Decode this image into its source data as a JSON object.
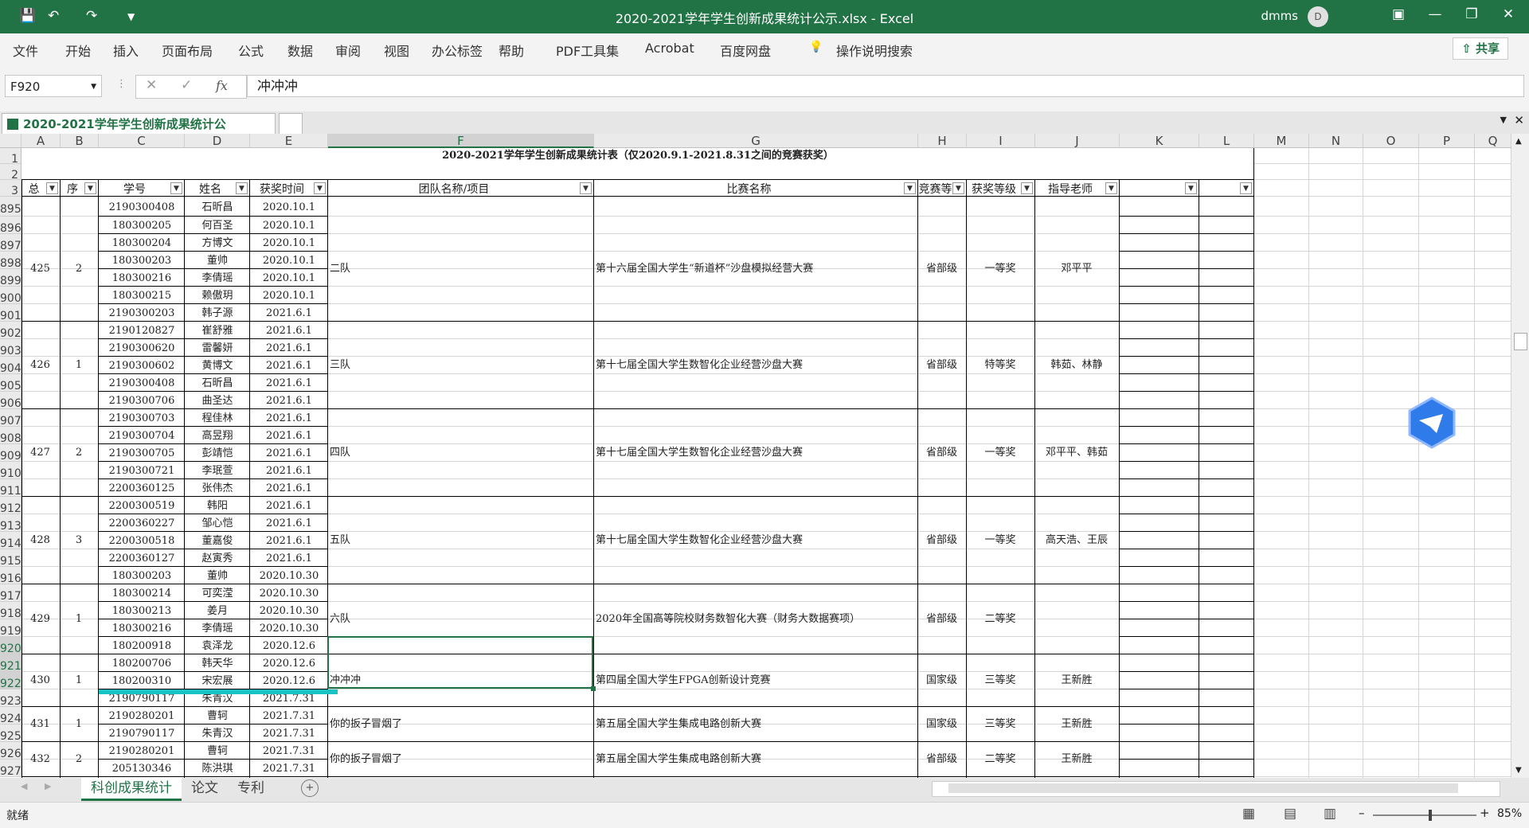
{
  "window": {
    "title": "2020-2021学年学生创新成果统计公示.xlsx  -  Excel",
    "user": "dmms",
    "avatar_letter": "D"
  },
  "menu": [
    "文件",
    "开始",
    "插入",
    "页面布局",
    "公式",
    "数据",
    "审阅",
    "视图",
    "办公标签",
    "帮助",
    "PDF工具集",
    "Acrobat",
    "百度网盘"
  ],
  "search_label": "操作说明搜索",
  "share_label": "共享",
  "formula_bar": {
    "name_box": "F920",
    "content": "冲冲冲",
    "fx": "fx"
  },
  "workbook_tab": {
    "label": "2020-2021学年学生创新成果统计公示.xlsx",
    "icon": "excel-icon"
  },
  "columns": [
    "A",
    "B",
    "C",
    "D",
    "E",
    "F",
    "G",
    "H",
    "I",
    "J",
    "K",
    "L",
    "M",
    "N",
    "O",
    "P",
    "Q"
  ],
  "sheet_title": "2020-2021学年学生创新成果统计表（仅2020.9.1-2021.8.31之间的竞赛获奖）",
  "headers": {
    "A": "总",
    "B": "序",
    "C": "学号",
    "D": "姓名",
    "E": "获奖时间",
    "F": "团队名称/项目",
    "G": "比赛名称",
    "H": "竞赛等",
    "I": "获奖等级",
    "J": "指导老师"
  },
  "rows_visible": [
    "1",
    "2",
    "3",
    "895",
    "896",
    "897",
    "898",
    "899",
    "900",
    "901",
    "902",
    "903",
    "904",
    "905",
    "906",
    "907",
    "908",
    "909",
    "910",
    "911",
    "912",
    "913",
    "914",
    "915",
    "916",
    "917",
    "918",
    "919",
    "920",
    "921",
    "922",
    "923",
    "924",
    "925",
    "926",
    "927"
  ],
  "students": [
    [
      "2190300408",
      "石昕昌",
      "2020.10.1"
    ],
    [
      "180300205",
      "何百圣",
      "2020.10.1"
    ],
    [
      "180300204",
      "方博文",
      "2020.10.1"
    ],
    [
      "180300203",
      "董帅",
      "2020.10.1"
    ],
    [
      "180300216",
      "李倩瑶",
      "2020.10.1"
    ],
    [
      "180300215",
      "赖傲玥",
      "2020.10.1"
    ],
    [
      "2190300203",
      "韩子源",
      "2021.6.1"
    ],
    [
      "2190120827",
      "崔舒雅",
      "2021.6.1"
    ],
    [
      "2190300620",
      "雷馨妍",
      "2021.6.1"
    ],
    [
      "2190300602",
      "黄博文",
      "2021.6.1"
    ],
    [
      "2190300408",
      "石昕昌",
      "2021.6.1"
    ],
    [
      "2190300706",
      "曲圣达",
      "2021.6.1"
    ],
    [
      "2190300703",
      "程佳林",
      "2021.6.1"
    ],
    [
      "2190300704",
      "高昱翔",
      "2021.6.1"
    ],
    [
      "2190300705",
      "彭靖恺",
      "2021.6.1"
    ],
    [
      "2190300721",
      "李珉萱",
      "2021.6.1"
    ],
    [
      "2200360125",
      "张伟杰",
      "2021.6.1"
    ],
    [
      "2200300519",
      "韩阳",
      "2021.6.1"
    ],
    [
      "2200360227",
      "邹心恺",
      "2021.6.1"
    ],
    [
      "2200300518",
      "董嘉俊",
      "2021.6.1"
    ],
    [
      "2200360127",
      "赵寅秀",
      "2021.6.1"
    ],
    [
      "180300203",
      "董帅",
      "2020.10.30"
    ],
    [
      "180300214",
      "可奕滢",
      "2020.10.30"
    ],
    [
      "180300213",
      "姜月",
      "2020.10.30"
    ],
    [
      "180300216",
      "李倩瑶",
      "2020.10.30"
    ],
    [
      "180200918",
      "袁泽龙",
      "2020.12.6"
    ],
    [
      "180200706",
      "韩天华",
      "2020.12.6"
    ],
    [
      "180200310",
      "宋宏展",
      "2020.12.6"
    ],
    [
      "2190790117",
      "朱青汉",
      "2021.7.31"
    ],
    [
      "2190280201",
      "曹轲",
      "2021.7.31"
    ],
    [
      "2190790117",
      "朱青汉",
      "2021.7.31"
    ],
    [
      "2190280201",
      "曹轲",
      "2021.7.31"
    ],
    [
      "205130346",
      "陈洪琪",
      "2021.7.31"
    ]
  ],
  "groups": [
    {
      "total": "425",
      "seq": "2",
      "team": "二队",
      "comp": "第十六届全国大学生“新道杯”沙盘模拟经营大赛",
      "level": "省部级",
      "award": "一等奖",
      "teacher": "邓平平"
    },
    {
      "total": "426",
      "seq": "1",
      "team": "三队",
      "comp": "第十七届全国大学生数智化企业经营沙盘大赛",
      "level": "省部级",
      "award": "特等奖",
      "teacher": "韩茹、林静"
    },
    {
      "total": "427",
      "seq": "2",
      "team": "四队",
      "comp": "第十七届全国大学生数智化企业经营沙盘大赛",
      "level": "省部级",
      "award": "一等奖",
      "teacher": "邓平平、韩茹"
    },
    {
      "total": "428",
      "seq": "3",
      "team": "五队",
      "comp": "第十七届全国大学生数智化企业经营沙盘大赛",
      "level": "省部级",
      "award": "一等奖",
      "teacher": "高天浩、王辰"
    },
    {
      "total": "429",
      "seq": "1",
      "team": "六队",
      "comp": "2020年全国高等院校财务数智化大赛（财务大数据赛项）",
      "level": "省部级",
      "award": "二等奖",
      "teacher": ""
    },
    {
      "total": "430",
      "seq": "1",
      "team": "冲冲冲",
      "comp": "第四届全国大学生FPGA创新设计竞赛",
      "level": "国家级",
      "award": "三等奖",
      "teacher": "王新胜"
    },
    {
      "total": "431",
      "seq": "1",
      "team": "你的扳子冒烟了",
      "comp": "第五届全国大学生集成电路创新大赛",
      "level": "国家级",
      "award": "三等奖",
      "teacher": "王新胜"
    },
    {
      "total": "432",
      "seq": "2",
      "team": "你的扳子冒烟了",
      "comp": "第五届全国大学生集成电路创新大赛",
      "level": "省部级",
      "award": "二等奖",
      "teacher": "王新胜"
    }
  ],
  "sheet_tabs": [
    "科创成果统计",
    "论文",
    "专利"
  ],
  "status": {
    "ready": "就绪",
    "zoom": "85%"
  }
}
